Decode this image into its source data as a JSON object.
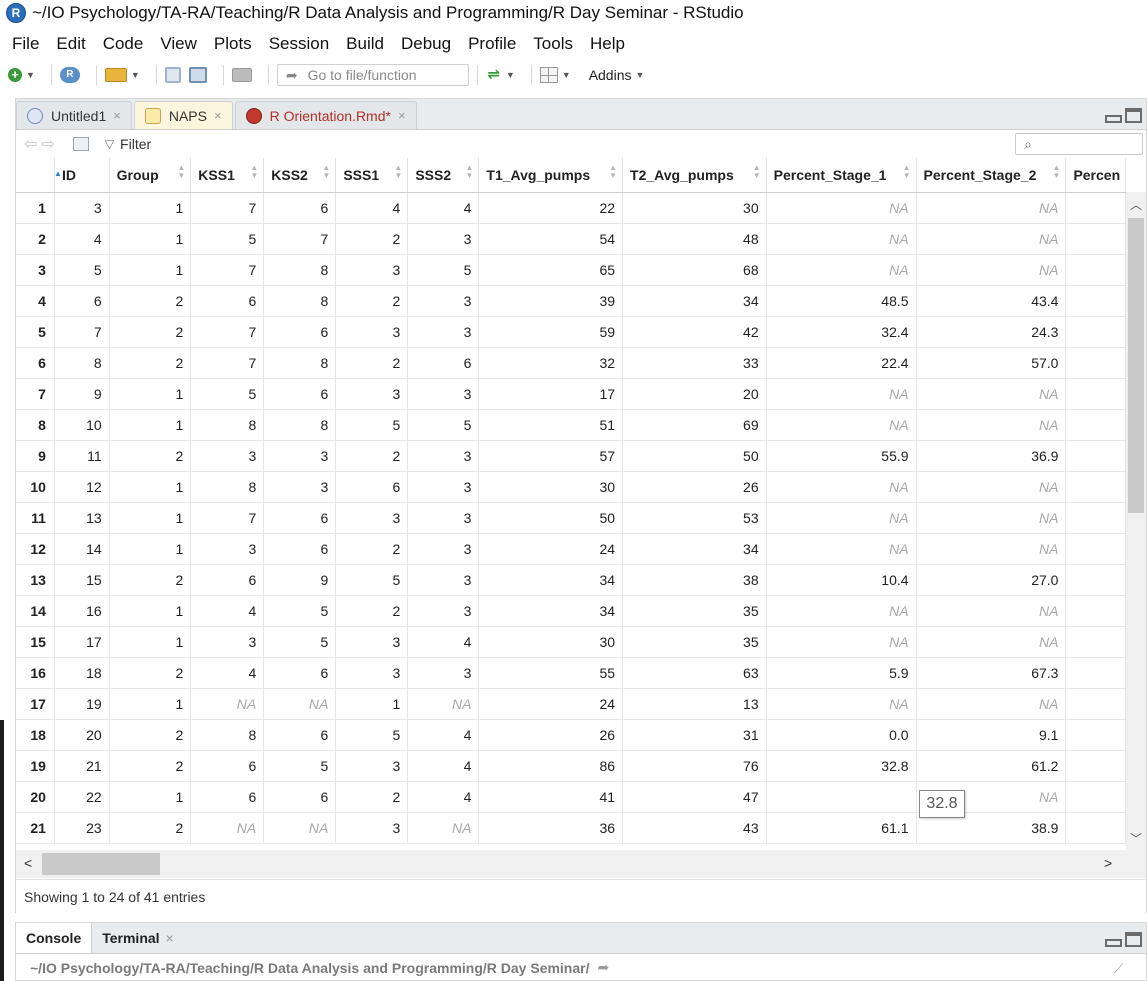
{
  "window": {
    "title": "~/IO Psychology/TA-RA/Teaching/R Data Analysis and Programming/R Day Seminar - RStudio",
    "app_logo": "R"
  },
  "menu": [
    "File",
    "Edit",
    "Code",
    "View",
    "Plots",
    "Session",
    "Build",
    "Debug",
    "Profile",
    "Tools",
    "Help"
  ],
  "toolbar": {
    "goto_placeholder": "Go to file/function",
    "addins_label": "Addins",
    "icons": [
      "new-file-icon",
      "new-project-icon",
      "open-folder-icon",
      "save-icon",
      "save-all-icon",
      "print-icon",
      "knit-icon",
      "grid-layout-icon"
    ]
  },
  "editor": {
    "tabs": [
      {
        "label": "Untitled1",
        "icon": "r-script-icon",
        "active": false
      },
      {
        "label": "NAPS",
        "icon": "data-table-icon",
        "active": true
      },
      {
        "label": "R Orientation.Rmd*",
        "icon": "rmarkdown-icon",
        "active": false
      }
    ],
    "close_glyph": "×",
    "filter_label": "Filter"
  },
  "table": {
    "columns": [
      "ID",
      "Group",
      "KSS1",
      "KSS2",
      "SSS1",
      "SSS2",
      "T1_Avg_pumps",
      "T2_Avg_pumps",
      "Percent_Stage_1",
      "Percent_Stage_2",
      "Percen"
    ],
    "rows": [
      [
        "1",
        "3",
        "1",
        "7",
        "6",
        "4",
        "4",
        "22",
        "30",
        "NA",
        "NA"
      ],
      [
        "2",
        "4",
        "1",
        "5",
        "7",
        "2",
        "3",
        "54",
        "48",
        "NA",
        "NA"
      ],
      [
        "3",
        "5",
        "1",
        "7",
        "8",
        "3",
        "5",
        "65",
        "68",
        "NA",
        "NA"
      ],
      [
        "4",
        "6",
        "2",
        "6",
        "8",
        "2",
        "3",
        "39",
        "34",
        "48.5",
        "43.4"
      ],
      [
        "5",
        "7",
        "2",
        "7",
        "6",
        "3",
        "3",
        "59",
        "42",
        "32.4",
        "24.3"
      ],
      [
        "6",
        "8",
        "2",
        "7",
        "8",
        "2",
        "6",
        "32",
        "33",
        "22.4",
        "57.0"
      ],
      [
        "7",
        "9",
        "1",
        "5",
        "6",
        "3",
        "3",
        "17",
        "20",
        "NA",
        "NA"
      ],
      [
        "8",
        "10",
        "1",
        "8",
        "8",
        "5",
        "5",
        "51",
        "69",
        "NA",
        "NA"
      ],
      [
        "9",
        "11",
        "2",
        "3",
        "3",
        "2",
        "3",
        "57",
        "50",
        "55.9",
        "36.9"
      ],
      [
        "10",
        "12",
        "1",
        "8",
        "3",
        "6",
        "3",
        "30",
        "26",
        "NA",
        "NA"
      ],
      [
        "11",
        "13",
        "1",
        "7",
        "6",
        "3",
        "3",
        "50",
        "53",
        "NA",
        "NA"
      ],
      [
        "12",
        "14",
        "1",
        "3",
        "6",
        "2",
        "3",
        "24",
        "34",
        "NA",
        "NA"
      ],
      [
        "13",
        "15",
        "2",
        "6",
        "9",
        "5",
        "3",
        "34",
        "38",
        "10.4",
        "27.0"
      ],
      [
        "14",
        "16",
        "1",
        "4",
        "5",
        "2",
        "3",
        "34",
        "35",
        "NA",
        "NA"
      ],
      [
        "15",
        "17",
        "1",
        "3",
        "5",
        "3",
        "4",
        "30",
        "35",
        "NA",
        "NA"
      ],
      [
        "16",
        "18",
        "2",
        "4",
        "6",
        "3",
        "3",
        "55",
        "63",
        "5.9",
        "67.3"
      ],
      [
        "17",
        "19",
        "1",
        "NA",
        "NA",
        "1",
        "NA",
        "24",
        "13",
        "NA",
        "NA"
      ],
      [
        "18",
        "20",
        "2",
        "8",
        "6",
        "5",
        "4",
        "26",
        "31",
        "0.0",
        "9.1"
      ],
      [
        "19",
        "21",
        "2",
        "6",
        "5",
        "3",
        "4",
        "86",
        "76",
        "32.8",
        "61.2"
      ],
      [
        "20",
        "22",
        "1",
        "6",
        "6",
        "2",
        "4",
        "41",
        "47",
        "",
        "NA"
      ],
      [
        "21",
        "23",
        "2",
        "NA",
        "NA",
        "3",
        "NA",
        "36",
        "43",
        "61.1",
        "38.9"
      ]
    ],
    "tooltip": "32.8",
    "status": "Showing 1 to 24 of 41 entries"
  },
  "console": {
    "tabs": [
      {
        "label": "Console",
        "active": true
      },
      {
        "label": "Terminal",
        "active": false
      }
    ],
    "path": "~/IO Psychology/TA-RA/Teaching/R Data Analysis and Programming/R Day Seminar/"
  }
}
